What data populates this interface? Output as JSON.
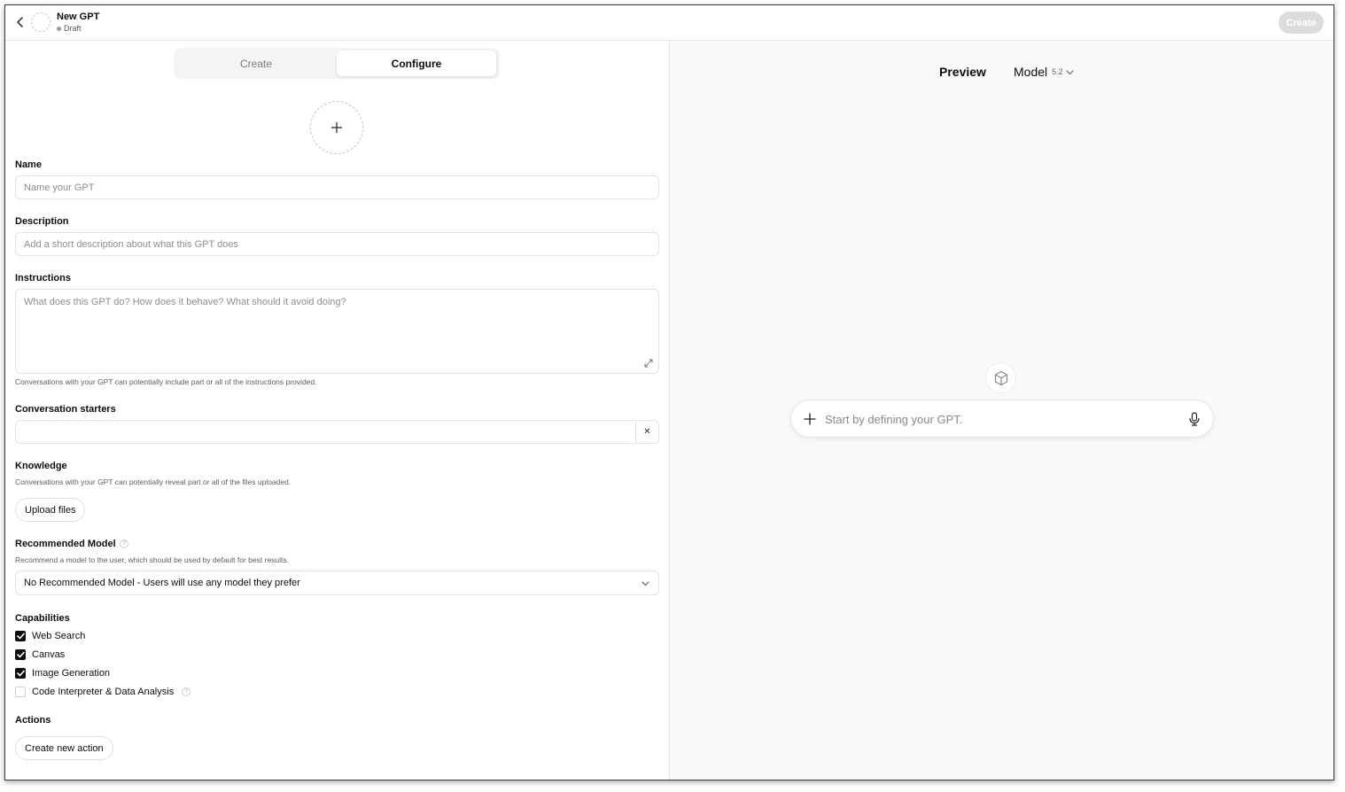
{
  "header": {
    "title": "New GPT",
    "status": "Draft",
    "create_label": "Create"
  },
  "tabs": [
    {
      "label": "Create",
      "active": false
    },
    {
      "label": "Configure",
      "active": true
    }
  ],
  "form": {
    "name": {
      "label": "Name",
      "placeholder": "Name your GPT",
      "value": ""
    },
    "description": {
      "label": "Description",
      "placeholder": "Add a short description about what this GPT does",
      "value": ""
    },
    "instructions": {
      "label": "Instructions",
      "placeholder": "What does this GPT do? How does it behave? What should it avoid doing?",
      "value": "",
      "helper": "Conversations with your GPT can potentially include part or all of the instructions provided."
    },
    "conversation_starters": {
      "label": "Conversation starters",
      "remove_glyph": "✕"
    },
    "knowledge": {
      "label": "Knowledge",
      "helper": "Conversations with your GPT can potentially reveal part or all of the files uploaded.",
      "upload_label": "Upload files"
    },
    "recommended_model": {
      "label": "Recommended Model",
      "help_glyph": "?",
      "helper": "Recommend a model to the user, which should be used by default for best results.",
      "selected": "No Recommended Model - Users will use any model they prefer"
    },
    "capabilities": {
      "label": "Capabilities",
      "items": [
        {
          "label": "Web Search",
          "checked": true
        },
        {
          "label": "Canvas",
          "checked": true
        },
        {
          "label": "Image Generation",
          "checked": true
        },
        {
          "label": "Code Interpreter & Data Analysis",
          "checked": false
        }
      ]
    },
    "actions": {
      "label": "Actions",
      "create_label": "Create new action"
    }
  },
  "preview": {
    "label": "Preview",
    "model_label": "Model",
    "model_version": "5.2",
    "composer_placeholder": "Start by defining your GPT."
  },
  "colors": {
    "accent_dark": "#0d0d0d",
    "preview_bg": "#f9f9f9",
    "disabled_button": "#dcdcdc"
  }
}
